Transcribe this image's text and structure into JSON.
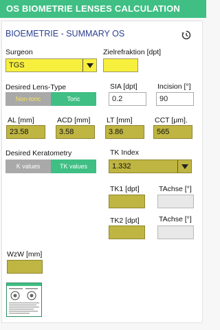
{
  "header": {
    "title": "OS BIOMETRIE LENSES CALCULATION"
  },
  "section": {
    "title": "BIOEMETRIE - SUMMARY OS"
  },
  "surgeon": {
    "label": "Surgeon",
    "value": "TGS"
  },
  "zielrefraktion": {
    "label": "Zielrefraktion [dpt]",
    "value": ""
  },
  "lens_type": {
    "label": "Desired Lens-Type",
    "options": [
      "Non-toric",
      "Toric"
    ],
    "selected": "Toric"
  },
  "sia": {
    "label": "SIA [dpt]",
    "value": "0.2"
  },
  "incision": {
    "label": "Incision [°]",
    "value": "90"
  },
  "al": {
    "label": "AL [mm]",
    "value": "23.58"
  },
  "acd": {
    "label": "ACD [mm]",
    "value": "3.58"
  },
  "lt": {
    "label": "LT [mm]",
    "value": "3.86"
  },
  "cct": {
    "label": "CCT [μm].",
    "value": "565"
  },
  "keratometry": {
    "label": "Desired Keratometry",
    "options": [
      "K values",
      "TK values"
    ],
    "selected": "TK values"
  },
  "tk_index": {
    "label": "TK Index",
    "value": "1.332"
  },
  "tk1": {
    "label": "TK1 [dpt]",
    "value": ""
  },
  "tachse1": {
    "label": "TAchse [°]",
    "value": ""
  },
  "tk2": {
    "label": "TK2 [dpt]",
    "value": ""
  },
  "tachse2": {
    "label": "TAchse [°]",
    "value": ""
  },
  "wzw": {
    "label": "WzW [mm]",
    "value": ""
  },
  "icons": {
    "history": "history-icon",
    "dropdown": "chevron-down-icon",
    "thumbnail": "biometry-printout-thumbnail"
  },
  "colors": {
    "accent": "#3fbf84",
    "olive": "#bfb542",
    "yellow": "#f7ef3d",
    "title_blue": "#2a3f8f"
  }
}
